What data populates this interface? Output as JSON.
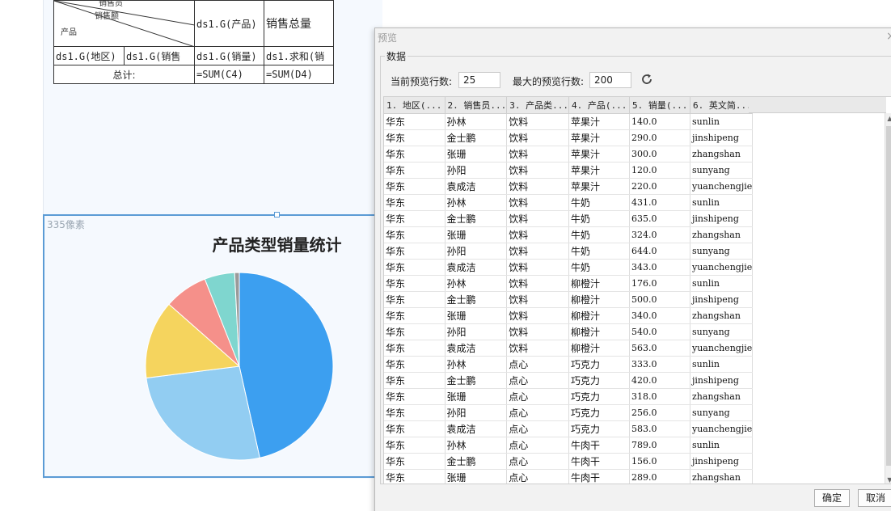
{
  "report": {
    "diagonal_header": {
      "label_top": "销售员",
      "label_mid": "销售额",
      "label_bottom": "产品"
    },
    "header_product": "ds1.G(产品)",
    "header_total": "销售总量",
    "row2": [
      "ds1.G(地区)",
      "ds1.G(销售",
      "ds1.G(销量)",
      "ds1.求和(销"
    ],
    "total_label": "总计:",
    "total_formula_c": "=SUM(C4)",
    "total_formula_d": "=SUM(D4)"
  },
  "chart": {
    "size_label": "335像素",
    "colors": [
      "#3c9ff0",
      "#92cdf2",
      "#f5d45e",
      "#f5908a",
      "#7fd6cf",
      "#9a9a9a"
    ]
  },
  "chart_data": {
    "type": "pie",
    "title": "产品类型销量统计",
    "values": [
      46.5,
      26.5,
      13.5,
      7.5,
      5.2,
      0.8
    ]
  },
  "dialog": {
    "title": "预览",
    "close_icon": "close-icon",
    "group_label": "数据",
    "current_rows_label": "当前预览行数:",
    "current_rows_value": "25",
    "max_rows_label": "最大的预览行数:",
    "max_rows_value": "200",
    "refresh_icon": "refresh-icon",
    "ok_label": "确定",
    "cancel_label": "取消"
  },
  "grid": {
    "columns": [
      "1. 地区(...",
      "2. 销售员...",
      "3. 产品类...",
      "4. 产品(...",
      "5. 销量(...",
      "6. 英文简..."
    ],
    "rows": [
      [
        "华东",
        "孙林",
        "饮料",
        "苹果汁",
        "140.0",
        "sunlin"
      ],
      [
        "华东",
        "金士鹏",
        "饮料",
        "苹果汁",
        "290.0",
        "jinshipeng"
      ],
      [
        "华东",
        "张珊",
        "饮料",
        "苹果汁",
        "300.0",
        "zhangshan"
      ],
      [
        "华东",
        "孙阳",
        "饮料",
        "苹果汁",
        "120.0",
        "sunyang"
      ],
      [
        "华东",
        "袁成洁",
        "饮料",
        "苹果汁",
        "220.0",
        "yuanchengjie"
      ],
      [
        "华东",
        "孙林",
        "饮料",
        "牛奶",
        "431.0",
        "sunlin"
      ],
      [
        "华东",
        "金士鹏",
        "饮料",
        "牛奶",
        "635.0",
        "jinshipeng"
      ],
      [
        "华东",
        "张珊",
        "饮料",
        "牛奶",
        "324.0",
        "zhangshan"
      ],
      [
        "华东",
        "孙阳",
        "饮料",
        "牛奶",
        "644.0",
        "sunyang"
      ],
      [
        "华东",
        "袁成洁",
        "饮料",
        "牛奶",
        "343.0",
        "yuanchengjie"
      ],
      [
        "华东",
        "孙林",
        "饮料",
        "柳橙汁",
        "176.0",
        "sunlin"
      ],
      [
        "华东",
        "金士鹏",
        "饮料",
        "柳橙汁",
        "500.0",
        "jinshipeng"
      ],
      [
        "华东",
        "张珊",
        "饮料",
        "柳橙汁",
        "340.0",
        "zhangshan"
      ],
      [
        "华东",
        "孙阳",
        "饮料",
        "柳橙汁",
        "540.0",
        "sunyang"
      ],
      [
        "华东",
        "袁成洁",
        "饮料",
        "柳橙汁",
        "563.0",
        "yuanchengjie"
      ],
      [
        "华东",
        "孙林",
        "点心",
        "巧克力",
        "333.0",
        "sunlin"
      ],
      [
        "华东",
        "金士鹏",
        "点心",
        "巧克力",
        "420.0",
        "jinshipeng"
      ],
      [
        "华东",
        "张珊",
        "点心",
        "巧克力",
        "318.0",
        "zhangshan"
      ],
      [
        "华东",
        "孙阳",
        "点心",
        "巧克力",
        "256.0",
        "sunyang"
      ],
      [
        "华东",
        "袁成洁",
        "点心",
        "巧克力",
        "583.0",
        "yuanchengjie"
      ],
      [
        "华东",
        "孙林",
        "点心",
        "牛肉干",
        "789.0",
        "sunlin"
      ],
      [
        "华东",
        "金士鹏",
        "点心",
        "牛肉干",
        "156.0",
        "jinshipeng"
      ],
      [
        "华东",
        "张珊",
        "点心",
        "牛肉干",
        "289.0",
        "zhangshan"
      ]
    ]
  }
}
